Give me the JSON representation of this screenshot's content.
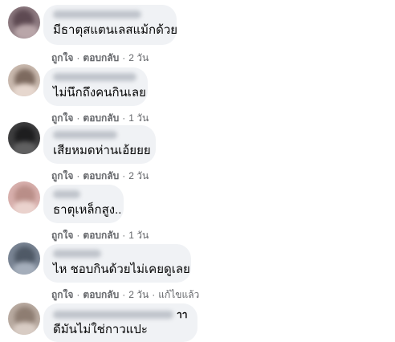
{
  "comments": [
    {
      "text": "มีธาตุสแตนเลสแม้กด้วย",
      "like_label": "ถูกใจ",
      "reply_label": "ตอบกลับ",
      "time": "2 วัน"
    },
    {
      "text": "ไม่นึกถึงคนกินเลย",
      "like_label": "ถูกใจ",
      "reply_label": "ตอบกลับ",
      "time": "1 วัน"
    },
    {
      "text": "เสียหมดห่านเอ้ยยย",
      "like_label": "ถูกใจ",
      "reply_label": "ตอบกลับ",
      "time": "2 วัน"
    },
    {
      "text": "ธาตุเหล็กสูง..",
      "like_label": "ถูกใจ",
      "reply_label": "ตอบกลับ",
      "time": "1 วัน"
    },
    {
      "text": "ไห ชอบกินด้วยไม่เคยดูเลย",
      "like_label": "ถูกใจ",
      "reply_label": "ตอบกลับ",
      "time": "2 วัน",
      "edited_label": "แก้ไขแล้ว"
    },
    {
      "name_suffix": "าา",
      "text": "ดีมันไม่ใช่กาวแปะ"
    }
  ],
  "colors": {
    "bubble": "#f0f2f5",
    "text": "#050505",
    "meta": "#65676b"
  }
}
